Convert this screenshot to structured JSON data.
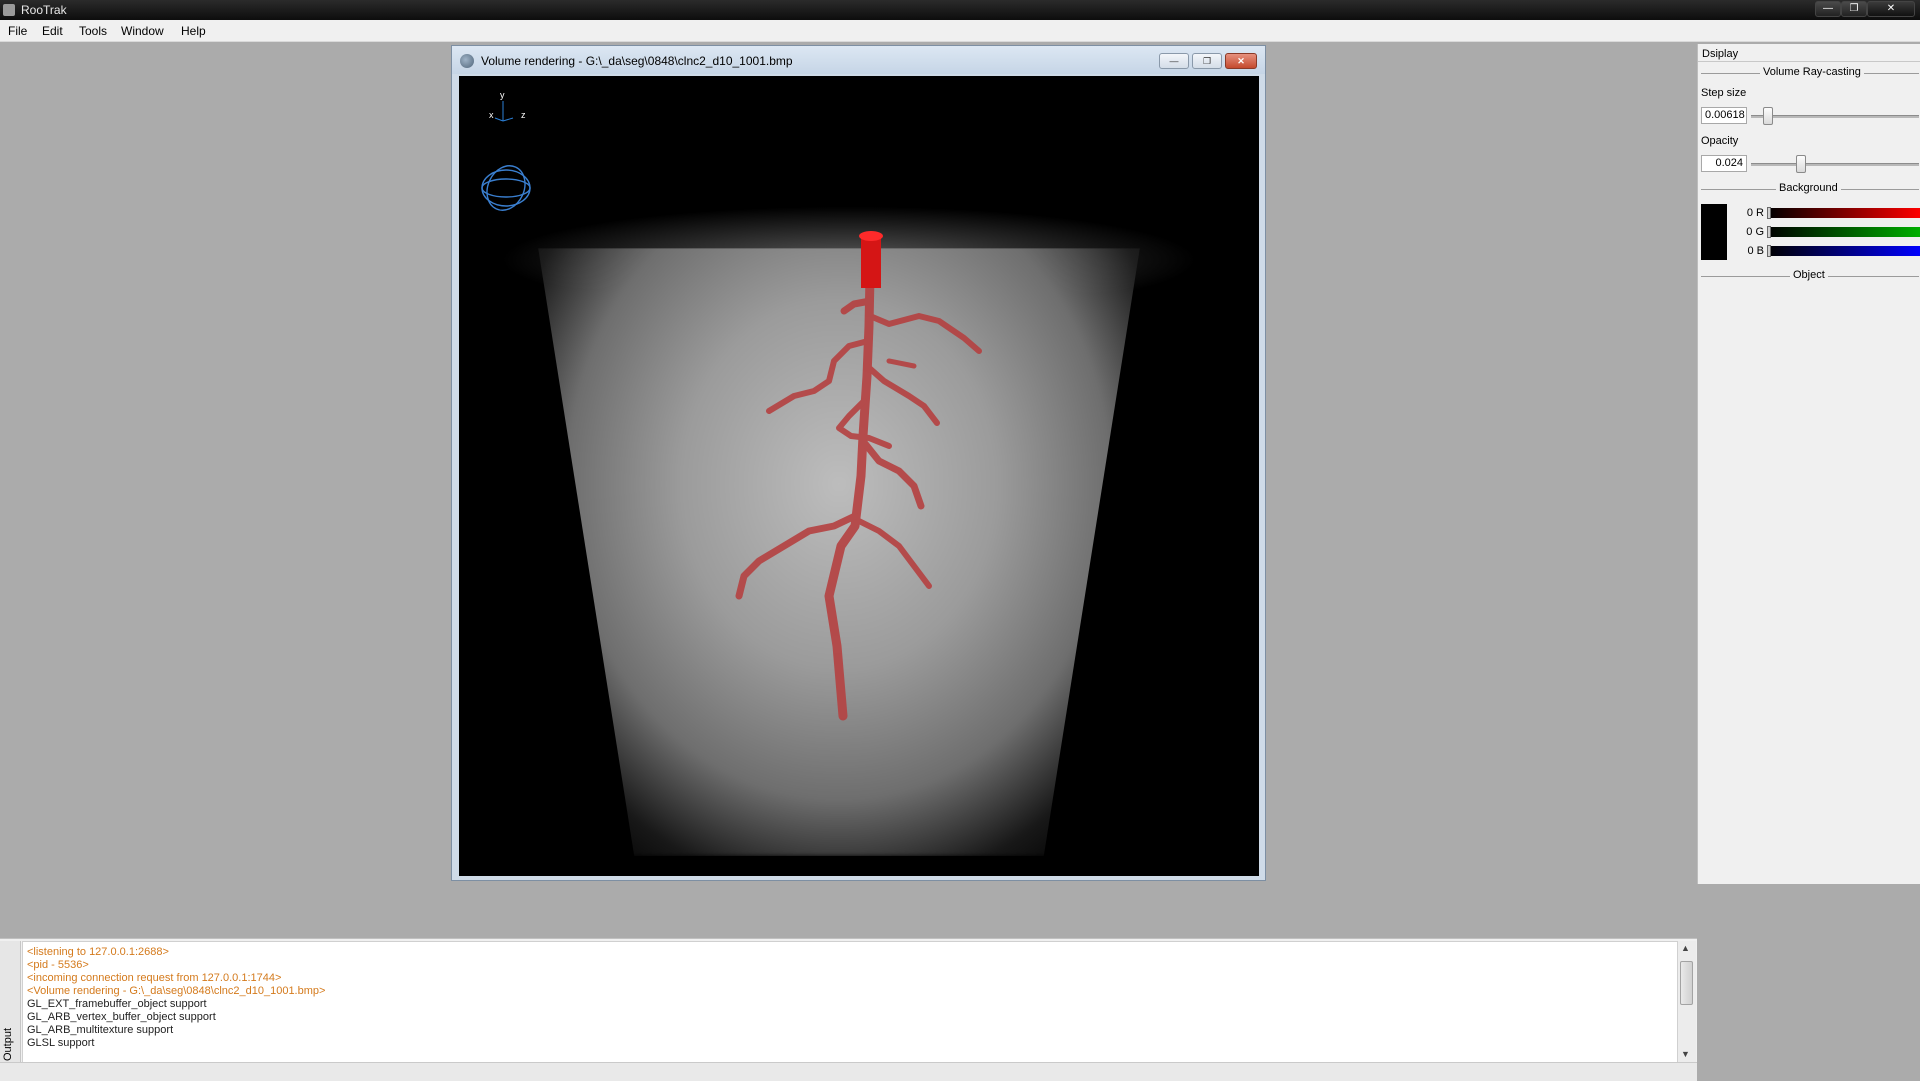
{
  "app": {
    "title": "RooTrak",
    "window_controls": {
      "min": "—",
      "max": "❐",
      "close": "✕"
    }
  },
  "menu": [
    "File",
    "Edit",
    "Tools",
    "Window",
    "Help"
  ],
  "child_window": {
    "title": "Volume rendering - G:\\_da\\seg\\0848\\clnc2_d10_1001.bmp",
    "controls": {
      "min": "—",
      "max": "❐",
      "close": "✕"
    },
    "axes": {
      "x": "x",
      "y": "y",
      "z": "z"
    }
  },
  "display_panel": {
    "title": "Dsiplay",
    "section_volume": "Volume Ray-casting",
    "step_size_label": "Step size",
    "step_size_value": "0.00618",
    "step_size_fraction": 0.1,
    "opacity_label": "Opacity",
    "opacity_value": "0.024",
    "opacity_fraction": 0.3,
    "section_background": "Background",
    "background": {
      "r_label": "0 R",
      "g_label": "0 G",
      "b_label": "0 B",
      "r": 0,
      "g": 0,
      "b": 0
    },
    "section_object": "Object",
    "colors": {
      "red": "#ff0000",
      "green": "#00b000",
      "blue": "#0000ff"
    }
  },
  "output": {
    "tab_label": "Output",
    "lines": [
      {
        "text": "<listening to 127.0.0.1:2688>",
        "kind": "orange"
      },
      {
        "text": "<pid - 5536>",
        "kind": "orange"
      },
      {
        "text": "<incoming connection request from 127.0.0.1:1744>",
        "kind": "orange"
      },
      {
        "text": "<Volume rendering - G:\\_da\\seg\\0848\\clnc2_d10_1001.bmp>",
        "kind": "orange"
      },
      {
        "text": "GL_EXT_framebuffer_object support",
        "kind": "dark"
      },
      {
        "text": "GL_ARB_vertex_buffer_object support",
        "kind": "dark"
      },
      {
        "text": "GL_ARB_multitexture support",
        "kind": "dark"
      },
      {
        "text": "GLSL support",
        "kind": "dark"
      }
    ],
    "scroll": {
      "up": "▲",
      "down": "▼"
    }
  }
}
